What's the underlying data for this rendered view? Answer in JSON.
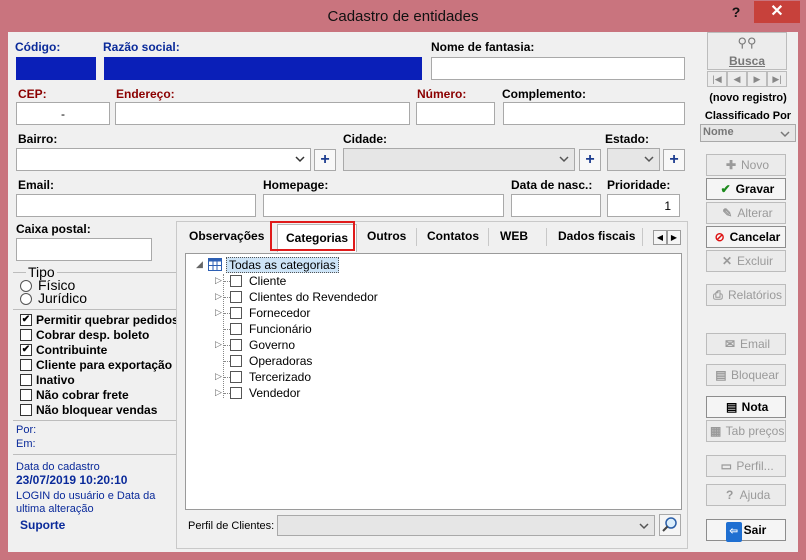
{
  "window": {
    "title": "Cadastro de entidades",
    "help": "?",
    "close": "✕"
  },
  "fields": {
    "codigo": {
      "label": "Código:",
      "value": ""
    },
    "razao_social": {
      "label": "Razão social:",
      "value": ""
    },
    "nome_fantasia": {
      "label": "Nome de fantasia:",
      "value": ""
    },
    "cep": {
      "label": "CEP:",
      "value": "-"
    },
    "endereco": {
      "label": "Endereço:",
      "value": ""
    },
    "numero": {
      "label": "Número:",
      "value": ""
    },
    "complemento": {
      "label": "Complemento:",
      "value": ""
    },
    "bairro": {
      "label": "Bairro:",
      "value": ""
    },
    "cidade": {
      "label": "Cidade:",
      "value": ""
    },
    "estado": {
      "label": "Estado:",
      "value": ""
    },
    "email": {
      "label": "Email:",
      "value": ""
    },
    "homepage": {
      "label": "Homepage:",
      "value": ""
    },
    "data_nasc": {
      "label": "Data de nasc.:",
      "value": ""
    },
    "prioridade": {
      "label": "Prioridade:",
      "value": "1"
    },
    "caixa_postal": {
      "label": "Caixa postal:",
      "value": ""
    }
  },
  "tipo": {
    "label": "Tipo",
    "options": [
      "Físico",
      "Jurídico"
    ]
  },
  "options": [
    {
      "label": "Permitir quebrar pedidos",
      "checked": true
    },
    {
      "label": "Cobrar desp. boleto",
      "checked": false
    },
    {
      "label": "Contribuinte",
      "checked": true
    },
    {
      "label": "Cliente para exportação",
      "checked": false
    },
    {
      "label": "Inativo",
      "checked": false
    },
    {
      "label": "Não cobrar frete",
      "checked": false
    },
    {
      "label": "Não bloquear vendas",
      "checked": false
    }
  ],
  "audit": {
    "por": "Por:",
    "em": "Em:",
    "data_cadastro_label": "Data do cadastro",
    "data_cadastro_value": "23/07/2019 10:20:10",
    "login_info": "LOGIN do usuário e Data da ultima alteração",
    "user": "Suporte"
  },
  "tabs": [
    "Observações",
    "Categorias",
    "Outros",
    "Contatos",
    "WEB",
    "Dados fiscais"
  ],
  "tree": {
    "root": "Todas as categorias",
    "children": [
      {
        "label": "Cliente",
        "expandable": true
      },
      {
        "label": "Clientes do Revendedor",
        "expandable": true
      },
      {
        "label": "Fornecedor",
        "expandable": true
      },
      {
        "label": "Funcionário",
        "expandable": false
      },
      {
        "label": "Governo",
        "expandable": true
      },
      {
        "label": "Operadoras",
        "expandable": false
      },
      {
        "label": "Tercerizado",
        "expandable": true
      },
      {
        "label": "Vendedor",
        "expandable": true
      }
    ]
  },
  "perfil": {
    "label": "Perfil de Clientes:",
    "value": ""
  },
  "sidebar": {
    "busca": "Busca",
    "status": "(novo registro)",
    "classificado_label": "Classificado Por",
    "classificado_value": "Nome",
    "buttons": {
      "novo": "Novo",
      "gravar": "Gravar",
      "alterar": "Alterar",
      "cancelar": "Cancelar",
      "excluir": "Excluir",
      "relatorios": "Relatórios",
      "email": "Email",
      "bloquear": "Bloquear",
      "nota": "Nota",
      "tab_precos": "Tab preços",
      "perfil": "Perfil...",
      "ajuda": "Ajuda",
      "sair": "Sair"
    }
  },
  "colors": {
    "title_bar": "#c9747e",
    "selection": "#0a1fb8",
    "close": "#c7413b",
    "highlight": "#e01b1b"
  }
}
